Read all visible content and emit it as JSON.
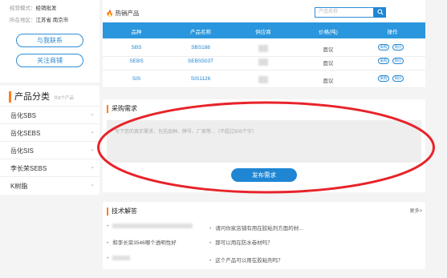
{
  "shop": {
    "mode_label": "经营模式：",
    "mode_value": "经销批发",
    "region_label": "所在地区：",
    "region_value": "江苏省 南京市",
    "contact_btn": "与我联系",
    "follow_btn": "关注商铺"
  },
  "categories": {
    "title": "产品分类",
    "count": "共8个产品",
    "items": [
      {
        "label": "岳化SBS"
      },
      {
        "label": "岳化SEBS"
      },
      {
        "label": "岳化SIS"
      },
      {
        "label": "李长荣SEBS"
      },
      {
        "label": "K树脂"
      }
    ],
    "chevron": "⌄"
  },
  "hot_products": {
    "title": "热销产品",
    "search_placeholder": "产品名称",
    "columns": [
      "品种",
      "产品名称",
      "供应商",
      "价格(吨)",
      "操作"
    ],
    "rows": [
      {
        "variety": "SBS",
        "name": "SBS188",
        "price": "面议"
      },
      {
        "variety": "SEBS",
        "name": "SEBS503T",
        "price": "面议"
      },
      {
        "variety": "SIS",
        "name": "SIS1126",
        "price": "面议"
      }
    ],
    "action1": "采购",
    "action2": "询价"
  },
  "purchase": {
    "title": "采购需求",
    "placeholder": "写下您的真实需求，包括品种、牌号、厂家等...（不超过500个字）",
    "submit": "发布需求"
  },
  "tech": {
    "title": "技术解答",
    "more": "更多>",
    "questions_right": [
      "请问你家店铺有用在胶粘剂方面的材...",
      "那可以用在防水卷材吗？",
      "这个产品可以用在胶粘剂吗？"
    ],
    "question_left_2": "和李长荣3546哪个透明性好"
  },
  "colors": {
    "accent": "#1f86d4",
    "header_bar": "#2a96dd",
    "orange": "#ff7f1f",
    "ellipse": "#e8232a"
  }
}
